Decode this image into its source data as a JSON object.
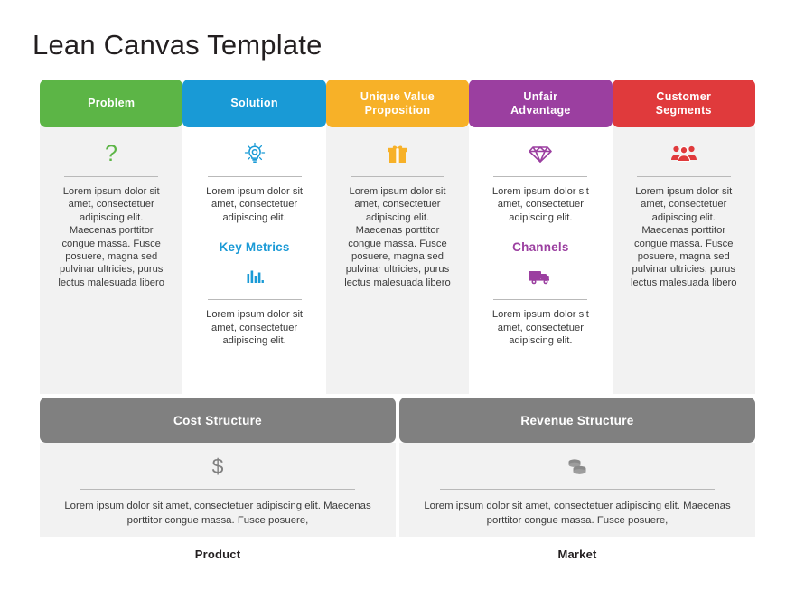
{
  "page": {
    "title": "Lean Canvas Template"
  },
  "lorem": {
    "long": "Lorem ipsum dolor sit amet, consectetuer adipiscing elit. Maecenas porttitor congue massa. Fusce posuere, magna sed pulvinar ultricies, purus lectus malesuada libero",
    "short": "Lorem ipsum dolor sit amet, consectetuer adipiscing elit.",
    "wide": "Lorem ipsum dolor sit amet, consectetuer adipiscing elit. Maecenas porttitor congue massa. Fusce posuere,"
  },
  "colors": {
    "problem": "#5cb546",
    "solution": "#199ad6",
    "uvp": "#f7b128",
    "unfair": "#9b3fa0",
    "customer": "#e03a3c",
    "bottom_bar": "#808080",
    "panel_shade": "#f2f2f2",
    "panel_plain": "#ffffff",
    "title_text": "#231f20",
    "body_text": "#3b3b3b",
    "divider": "#b9b9b9"
  },
  "columns": [
    {
      "key": "problem",
      "label": "Problem",
      "color": "#5cb546",
      "icon": "question-mark-icon",
      "body": "Lorem ipsum dolor sit amet, consectetuer adipiscing elit. Maecenas porttitor congue massa. Fusce posuere, magna sed pulvinar ultricies, purus lectus malesuada libero",
      "sub": null
    },
    {
      "key": "solution",
      "label": "Solution",
      "color": "#199ad6",
      "icon": "lightbulb-icon",
      "body": "Lorem ipsum dolor sit amet, consectetuer adipiscing elit.",
      "sub": {
        "label": "Key Metrics",
        "color": "#1b9ad6",
        "icon": "bar-chart-icon",
        "body": "Lorem ipsum dolor sit amet, consectetuer adipiscing elit."
      }
    },
    {
      "key": "uvp",
      "label": "Unique Value Proposition",
      "line1": "Unique Value",
      "line2": "Proposition",
      "color": "#f7b128",
      "icon": "gift-box-icon",
      "body": "Lorem ipsum dolor sit amet, consectetuer adipiscing elit. Maecenas porttitor congue massa. Fusce posuere, magna sed pulvinar ultricies, purus lectus malesuada libero",
      "sub": null
    },
    {
      "key": "unfair",
      "label": "Unfair Advantage",
      "line1": "Unfair",
      "line2": "Advantage",
      "color": "#9b3fa0",
      "icon": "diamond-gem-icon",
      "body": "Lorem ipsum dolor sit amet, consectetuer adipiscing elit.",
      "sub": {
        "label": "Channels",
        "color": "#9b3fa0",
        "icon": "delivery-truck-icon",
        "body": "Lorem ipsum dolor sit amet, consectetuer adipiscing elit."
      }
    },
    {
      "key": "customer",
      "label": "Customer Segments",
      "line1": "Customer",
      "line2": "Segments",
      "color": "#e03a3c",
      "icon": "people-group-icon",
      "body": "Lorem ipsum dolor sit amet, consectetuer adipiscing elit. Maecenas porttitor congue massa. Fusce posuere, magna sed pulvinar ultricies, purus lectus malesuada libero",
      "sub": null
    }
  ],
  "bottom": [
    {
      "key": "cost",
      "label": "Cost Structure",
      "icon": "dollar-sign-icon",
      "body": "Lorem ipsum dolor sit amet, consectetuer adipiscing elit. Maecenas porttitor congue massa. Fusce posuere,"
    },
    {
      "key": "revenue",
      "label": "Revenue Structure",
      "icon": "coins-stack-icon",
      "body": "Lorem ipsum dolor sit amet, consectetuer adipiscing elit. Maecenas porttitor congue massa. Fusce posuere,"
    }
  ],
  "footer": [
    {
      "key": "product",
      "label": "Product"
    },
    {
      "key": "market",
      "label": "Market"
    }
  ]
}
